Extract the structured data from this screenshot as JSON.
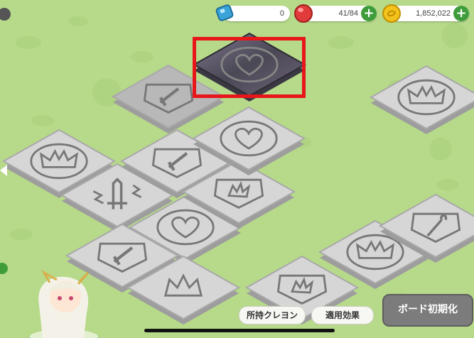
{
  "resources": {
    "gem": {
      "icon": "blue-gem-icon",
      "value": "0"
    },
    "stamina": {
      "icon": "red-jelly-icon",
      "value": "41/84"
    },
    "coins": {
      "icon": "gold-coin-icon",
      "value": "1,852,022"
    }
  },
  "buttons": {
    "owned_crayons": "所持クレヨン",
    "applied_effects": "適用効果",
    "board_reset": "ボード初期化"
  },
  "board": {
    "tiles": [
      {
        "name": "tile-crown-left",
        "icon": "crown",
        "state": "inactive"
      },
      {
        "name": "tile-sword-broken",
        "icon": "sword-broken",
        "state": "inactive"
      },
      {
        "name": "tile-shield-sword-1",
        "icon": "shield-sword",
        "state": "inactive"
      },
      {
        "name": "tile-heart-1",
        "icon": "heart",
        "state": "inactive"
      },
      {
        "name": "tile-shield-burst",
        "icon": "shield-burst",
        "state": "inactive"
      },
      {
        "name": "tile-heart-2",
        "icon": "heart",
        "state": "inactive"
      },
      {
        "name": "tile-shield-sword-2",
        "icon": "shield-sword",
        "state": "inactive"
      },
      {
        "name": "tile-burst-crown",
        "icon": "burst-crown",
        "state": "inactive"
      },
      {
        "name": "tile-shield-burst-2",
        "icon": "shield-burst",
        "state": "inactive"
      },
      {
        "name": "tile-crown-right",
        "icon": "crown",
        "state": "inactive"
      },
      {
        "name": "tile-shield-staff",
        "icon": "shield-staff",
        "state": "inactive"
      },
      {
        "name": "tile-crown-top-right",
        "icon": "crown",
        "state": "inactive"
      },
      {
        "name": "tile-unlocked-sword",
        "icon": "shield-sword",
        "state": "unlocked"
      },
      {
        "name": "tile-selected-heart",
        "icon": "heart",
        "state": "selected"
      }
    ]
  },
  "colors": {
    "background": "#b6d98a",
    "tile_face": "#d6d6d6",
    "tile_side": "#9d9d9d",
    "selected_tile": "#5d5a66",
    "highlight": "#e8161b",
    "plus_button": "#3e9d3a"
  }
}
